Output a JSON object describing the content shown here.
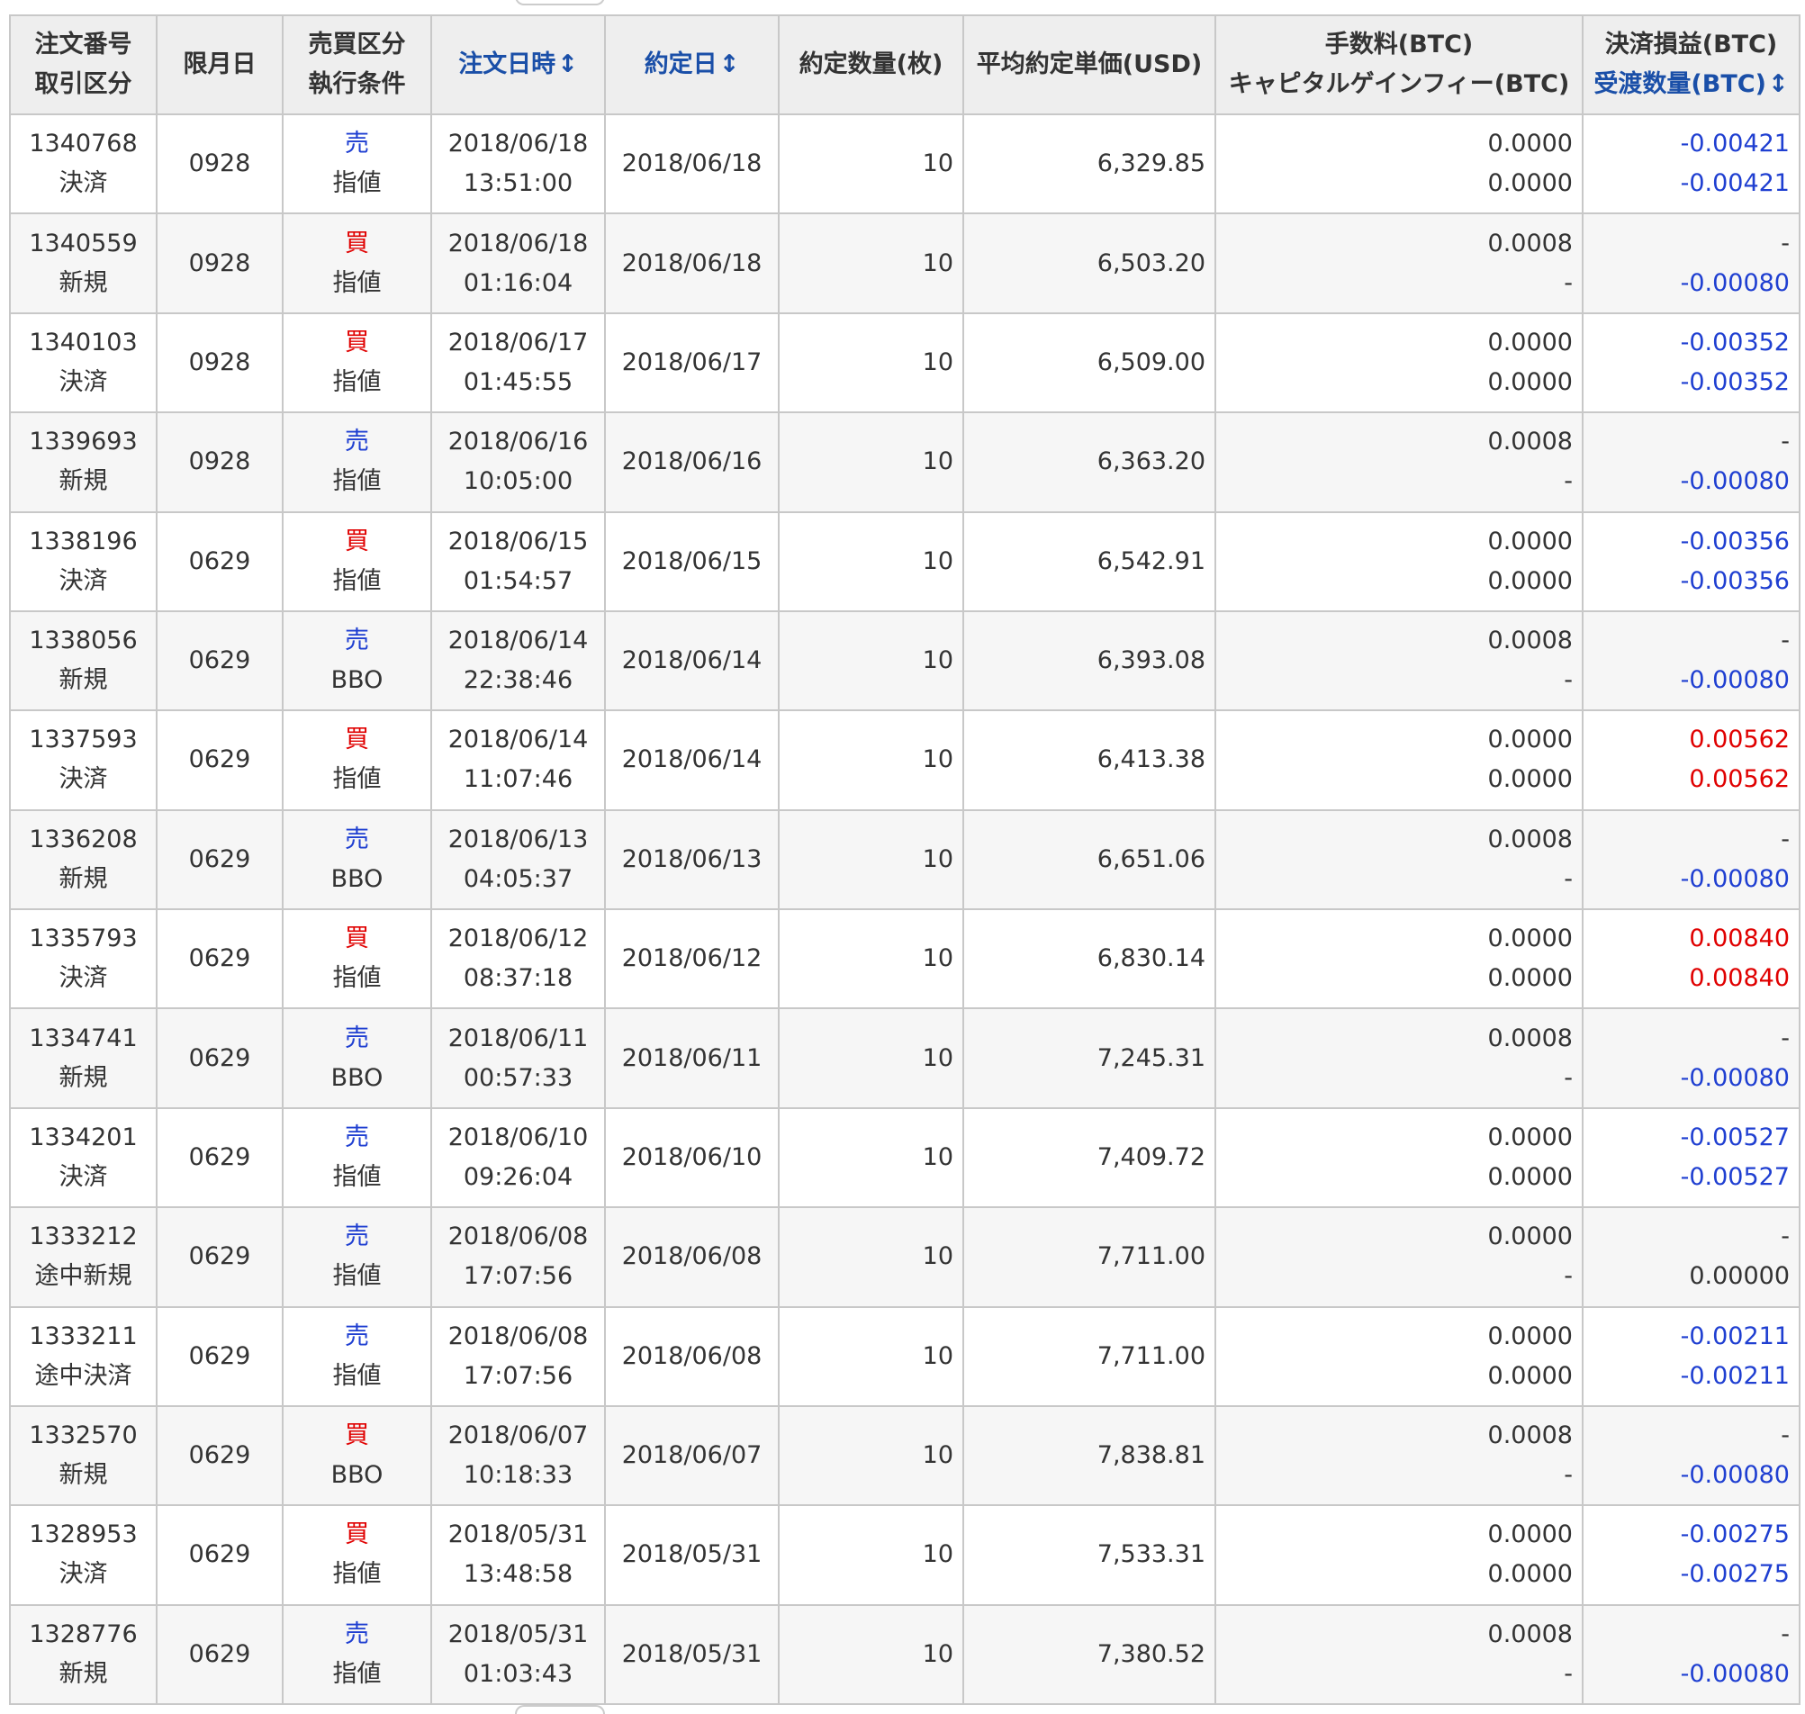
{
  "headers": {
    "order_no": "注文番号",
    "trade_type": "取引区分",
    "expiry": "限月日",
    "side": "売買区分",
    "condition": "執行条件",
    "order_datetime": "注文日時",
    "contract_date": "約定日",
    "quantity": "約定数量(枚)",
    "avg_price": "平均約定単価(USD)",
    "fee": "手数料(BTC)",
    "capital_gain_fee": "キャピタルゲインフィー(BTC)",
    "settlement_pnl": "決済損益(BTC)",
    "delivery_qty": "受渡数量(BTC)",
    "sort_icon": "↕"
  },
  "colors": {
    "sell": "#1f3fd1",
    "buy": "#e00000",
    "negative": "#1f3fd1",
    "positive": "#e00000",
    "header_link": "#1a4fa8"
  },
  "rows": [
    {
      "order_no": "1340768",
      "trade_type": "決済",
      "expiry": "0928",
      "side": "売",
      "side_kind": "sell",
      "condition": "指値",
      "order_date": "2018/06/18",
      "order_time": "13:51:00",
      "contract_date": "2018/06/18",
      "quantity": "10",
      "avg_price": "6,329.85",
      "fee": "0.0000",
      "cg_fee": "0.0000",
      "pnl": "-0.00421",
      "pnl_kind": "neg",
      "delivery": "-0.00421",
      "delivery_kind": "neg"
    },
    {
      "order_no": "1340559",
      "trade_type": "新規",
      "expiry": "0928",
      "side": "買",
      "side_kind": "buy",
      "condition": "指値",
      "order_date": "2018/06/18",
      "order_time": "01:16:04",
      "contract_date": "2018/06/18",
      "quantity": "10",
      "avg_price": "6,503.20",
      "fee": "0.0008",
      "cg_fee": "-",
      "pnl": "-",
      "pnl_kind": "zero",
      "delivery": "-0.00080",
      "delivery_kind": "neg"
    },
    {
      "order_no": "1340103",
      "trade_type": "決済",
      "expiry": "0928",
      "side": "買",
      "side_kind": "buy",
      "condition": "指値",
      "order_date": "2018/06/17",
      "order_time": "01:45:55",
      "contract_date": "2018/06/17",
      "quantity": "10",
      "avg_price": "6,509.00",
      "fee": "0.0000",
      "cg_fee": "0.0000",
      "pnl": "-0.00352",
      "pnl_kind": "neg",
      "delivery": "-0.00352",
      "delivery_kind": "neg"
    },
    {
      "order_no": "1339693",
      "trade_type": "新規",
      "expiry": "0928",
      "side": "売",
      "side_kind": "sell",
      "condition": "指値",
      "order_date": "2018/06/16",
      "order_time": "10:05:00",
      "contract_date": "2018/06/16",
      "quantity": "10",
      "avg_price": "6,363.20",
      "fee": "0.0008",
      "cg_fee": "-",
      "pnl": "-",
      "pnl_kind": "zero",
      "delivery": "-0.00080",
      "delivery_kind": "neg"
    },
    {
      "order_no": "1338196",
      "trade_type": "決済",
      "expiry": "0629",
      "side": "買",
      "side_kind": "buy",
      "condition": "指値",
      "order_date": "2018/06/15",
      "order_time": "01:54:57",
      "contract_date": "2018/06/15",
      "quantity": "10",
      "avg_price": "6,542.91",
      "fee": "0.0000",
      "cg_fee": "0.0000",
      "pnl": "-0.00356",
      "pnl_kind": "neg",
      "delivery": "-0.00356",
      "delivery_kind": "neg"
    },
    {
      "order_no": "1338056",
      "trade_type": "新規",
      "expiry": "0629",
      "side": "売",
      "side_kind": "sell",
      "condition": "BBO",
      "order_date": "2018/06/14",
      "order_time": "22:38:46",
      "contract_date": "2018/06/14",
      "quantity": "10",
      "avg_price": "6,393.08",
      "fee": "0.0008",
      "cg_fee": "-",
      "pnl": "-",
      "pnl_kind": "zero",
      "delivery": "-0.00080",
      "delivery_kind": "neg"
    },
    {
      "order_no": "1337593",
      "trade_type": "決済",
      "expiry": "0629",
      "side": "買",
      "side_kind": "buy",
      "condition": "指値",
      "order_date": "2018/06/14",
      "order_time": "11:07:46",
      "contract_date": "2018/06/14",
      "quantity": "10",
      "avg_price": "6,413.38",
      "fee": "0.0000",
      "cg_fee": "0.0000",
      "pnl": "0.00562",
      "pnl_kind": "pos",
      "delivery": "0.00562",
      "delivery_kind": "pos"
    },
    {
      "order_no": "1336208",
      "trade_type": "新規",
      "expiry": "0629",
      "side": "売",
      "side_kind": "sell",
      "condition": "BBO",
      "order_date": "2018/06/13",
      "order_time": "04:05:37",
      "contract_date": "2018/06/13",
      "quantity": "10",
      "avg_price": "6,651.06",
      "fee": "0.0008",
      "cg_fee": "-",
      "pnl": "-",
      "pnl_kind": "zero",
      "delivery": "-0.00080",
      "delivery_kind": "neg"
    },
    {
      "order_no": "1335793",
      "trade_type": "決済",
      "expiry": "0629",
      "side": "買",
      "side_kind": "buy",
      "condition": "指値",
      "order_date": "2018/06/12",
      "order_time": "08:37:18",
      "contract_date": "2018/06/12",
      "quantity": "10",
      "avg_price": "6,830.14",
      "fee": "0.0000",
      "cg_fee": "0.0000",
      "pnl": "0.00840",
      "pnl_kind": "pos",
      "delivery": "0.00840",
      "delivery_kind": "pos"
    },
    {
      "order_no": "1334741",
      "trade_type": "新規",
      "expiry": "0629",
      "side": "売",
      "side_kind": "sell",
      "condition": "BBO",
      "order_date": "2018/06/11",
      "order_time": "00:57:33",
      "contract_date": "2018/06/11",
      "quantity": "10",
      "avg_price": "7,245.31",
      "fee": "0.0008",
      "cg_fee": "-",
      "pnl": "-",
      "pnl_kind": "zero",
      "delivery": "-0.00080",
      "delivery_kind": "neg"
    },
    {
      "order_no": "1334201",
      "trade_type": "決済",
      "expiry": "0629",
      "side": "売",
      "side_kind": "sell",
      "condition": "指値",
      "order_date": "2018/06/10",
      "order_time": "09:26:04",
      "contract_date": "2018/06/10",
      "quantity": "10",
      "avg_price": "7,409.72",
      "fee": "0.0000",
      "cg_fee": "0.0000",
      "pnl": "-0.00527",
      "pnl_kind": "neg",
      "delivery": "-0.00527",
      "delivery_kind": "neg"
    },
    {
      "order_no": "1333212",
      "trade_type": "途中新規",
      "expiry": "0629",
      "side": "売",
      "side_kind": "sell",
      "condition": "指値",
      "order_date": "2018/06/08",
      "order_time": "17:07:56",
      "contract_date": "2018/06/08",
      "quantity": "10",
      "avg_price": "7,711.00",
      "fee": "0.0000",
      "cg_fee": "-",
      "pnl": "-",
      "pnl_kind": "zero",
      "delivery": "0.00000",
      "delivery_kind": "zero"
    },
    {
      "order_no": "1333211",
      "trade_type": "途中決済",
      "expiry": "0629",
      "side": "売",
      "side_kind": "sell",
      "condition": "指値",
      "order_date": "2018/06/08",
      "order_time": "17:07:56",
      "contract_date": "2018/06/08",
      "quantity": "10",
      "avg_price": "7,711.00",
      "fee": "0.0000",
      "cg_fee": "0.0000",
      "pnl": "-0.00211",
      "pnl_kind": "neg",
      "delivery": "-0.00211",
      "delivery_kind": "neg"
    },
    {
      "order_no": "1332570",
      "trade_type": "新規",
      "expiry": "0629",
      "side": "買",
      "side_kind": "buy",
      "condition": "BBO",
      "order_date": "2018/06/07",
      "order_time": "10:18:33",
      "contract_date": "2018/06/07",
      "quantity": "10",
      "avg_price": "7,838.81",
      "fee": "0.0008",
      "cg_fee": "-",
      "pnl": "-",
      "pnl_kind": "zero",
      "delivery": "-0.00080",
      "delivery_kind": "neg"
    },
    {
      "order_no": "1328953",
      "trade_type": "決済",
      "expiry": "0629",
      "side": "買",
      "side_kind": "buy",
      "condition": "指値",
      "order_date": "2018/05/31",
      "order_time": "13:48:58",
      "contract_date": "2018/05/31",
      "quantity": "10",
      "avg_price": "7,533.31",
      "fee": "0.0000",
      "cg_fee": "0.0000",
      "pnl": "-0.00275",
      "pnl_kind": "neg",
      "delivery": "-0.00275",
      "delivery_kind": "neg"
    },
    {
      "order_no": "1328776",
      "trade_type": "新規",
      "expiry": "0629",
      "side": "売",
      "side_kind": "sell",
      "condition": "指値",
      "order_date": "2018/05/31",
      "order_time": "01:03:43",
      "contract_date": "2018/05/31",
      "quantity": "10",
      "avg_price": "7,380.52",
      "fee": "0.0008",
      "cg_fee": "-",
      "pnl": "-",
      "pnl_kind": "zero",
      "delivery": "-0.00080",
      "delivery_kind": "neg"
    }
  ]
}
